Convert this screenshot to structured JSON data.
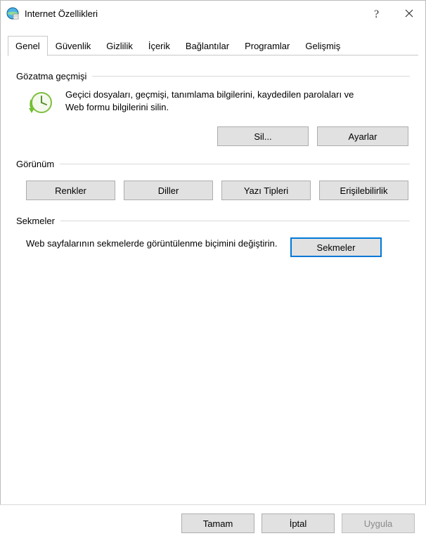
{
  "window": {
    "title": "Internet Özellikleri"
  },
  "tabs": {
    "items": [
      {
        "label": "Genel"
      },
      {
        "label": "Güvenlik"
      },
      {
        "label": "Gizlilik"
      },
      {
        "label": "İçerik"
      },
      {
        "label": "Bağlantılar"
      },
      {
        "label": "Programlar"
      },
      {
        "label": "Gelişmiş"
      }
    ],
    "active_index": 0
  },
  "history": {
    "title": "Gözatma geçmişi",
    "description": "Geçici dosyaları, geçmişi, tanımlama bilgilerini, kaydedilen parolaları ve Web formu bilgilerini silin.",
    "buttons": {
      "delete": "Sil...",
      "settings": "Ayarlar"
    }
  },
  "appearance": {
    "title": "Görünüm",
    "buttons": {
      "colors": "Renkler",
      "languages": "Diller",
      "fonts": "Yazı Tipleri",
      "accessibility": "Erişilebilirlik"
    }
  },
  "tabs_section": {
    "title": "Sekmeler",
    "description": "Web sayfalarının sekmelerde görüntülenme biçimini değiştirin.",
    "button": "Sekmeler"
  },
  "footer": {
    "ok": "Tamam",
    "cancel": "İptal",
    "apply": "Uygula"
  }
}
